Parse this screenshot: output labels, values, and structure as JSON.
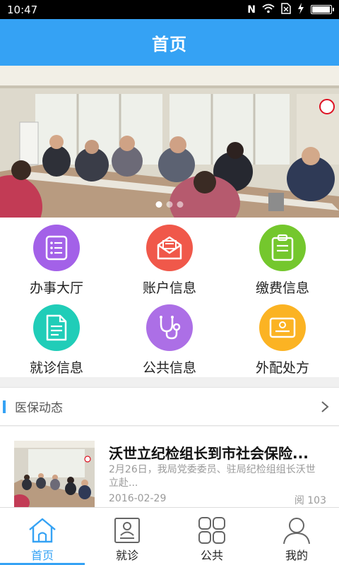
{
  "status_bar": {
    "time": "10:47",
    "icons": [
      "nfc-icon",
      "wifi-icon",
      "sim-icon",
      "charging-icon",
      "battery-icon"
    ],
    "battery_level": 0.9
  },
  "header": {
    "title": "首页"
  },
  "banner": {
    "slide_count": 3,
    "active_slide": 1
  },
  "services": [
    {
      "label": "办事大厅",
      "icon": "list-document-icon",
      "color": "#a361e8"
    },
    {
      "label": "账户信息",
      "icon": "envelope-icon",
      "color": "#f0584a"
    },
    {
      "label": "缴费信息",
      "icon": "clipboard-icon",
      "color": "#74c72d"
    },
    {
      "label": "就诊信息",
      "icon": "document-icon",
      "color": "#20cdb8"
    },
    {
      "label": "公共信息",
      "icon": "stethoscope-icon",
      "color": "#ac6fe6"
    },
    {
      "label": "外配处方",
      "icon": "certificate-icon",
      "color": "#fbb323"
    }
  ],
  "news_section": {
    "title": "医保动态"
  },
  "news": [
    {
      "title": "沃世立纪检组长到市社会保险...",
      "summary": "2月26日，我局党委委员、驻局纪检组组长沃世立赴...",
      "date": "2016-02-29",
      "reads": "阅 103"
    }
  ],
  "tabs": [
    {
      "label": "首页",
      "icon": "home-icon",
      "active": true
    },
    {
      "label": "就诊",
      "icon": "id-card-icon",
      "active": false
    },
    {
      "label": "公共",
      "icon": "grid-icon",
      "active": false
    },
    {
      "label": "我的",
      "icon": "user-icon",
      "active": false
    }
  ],
  "colors": {
    "accent": "#35a2f4"
  }
}
